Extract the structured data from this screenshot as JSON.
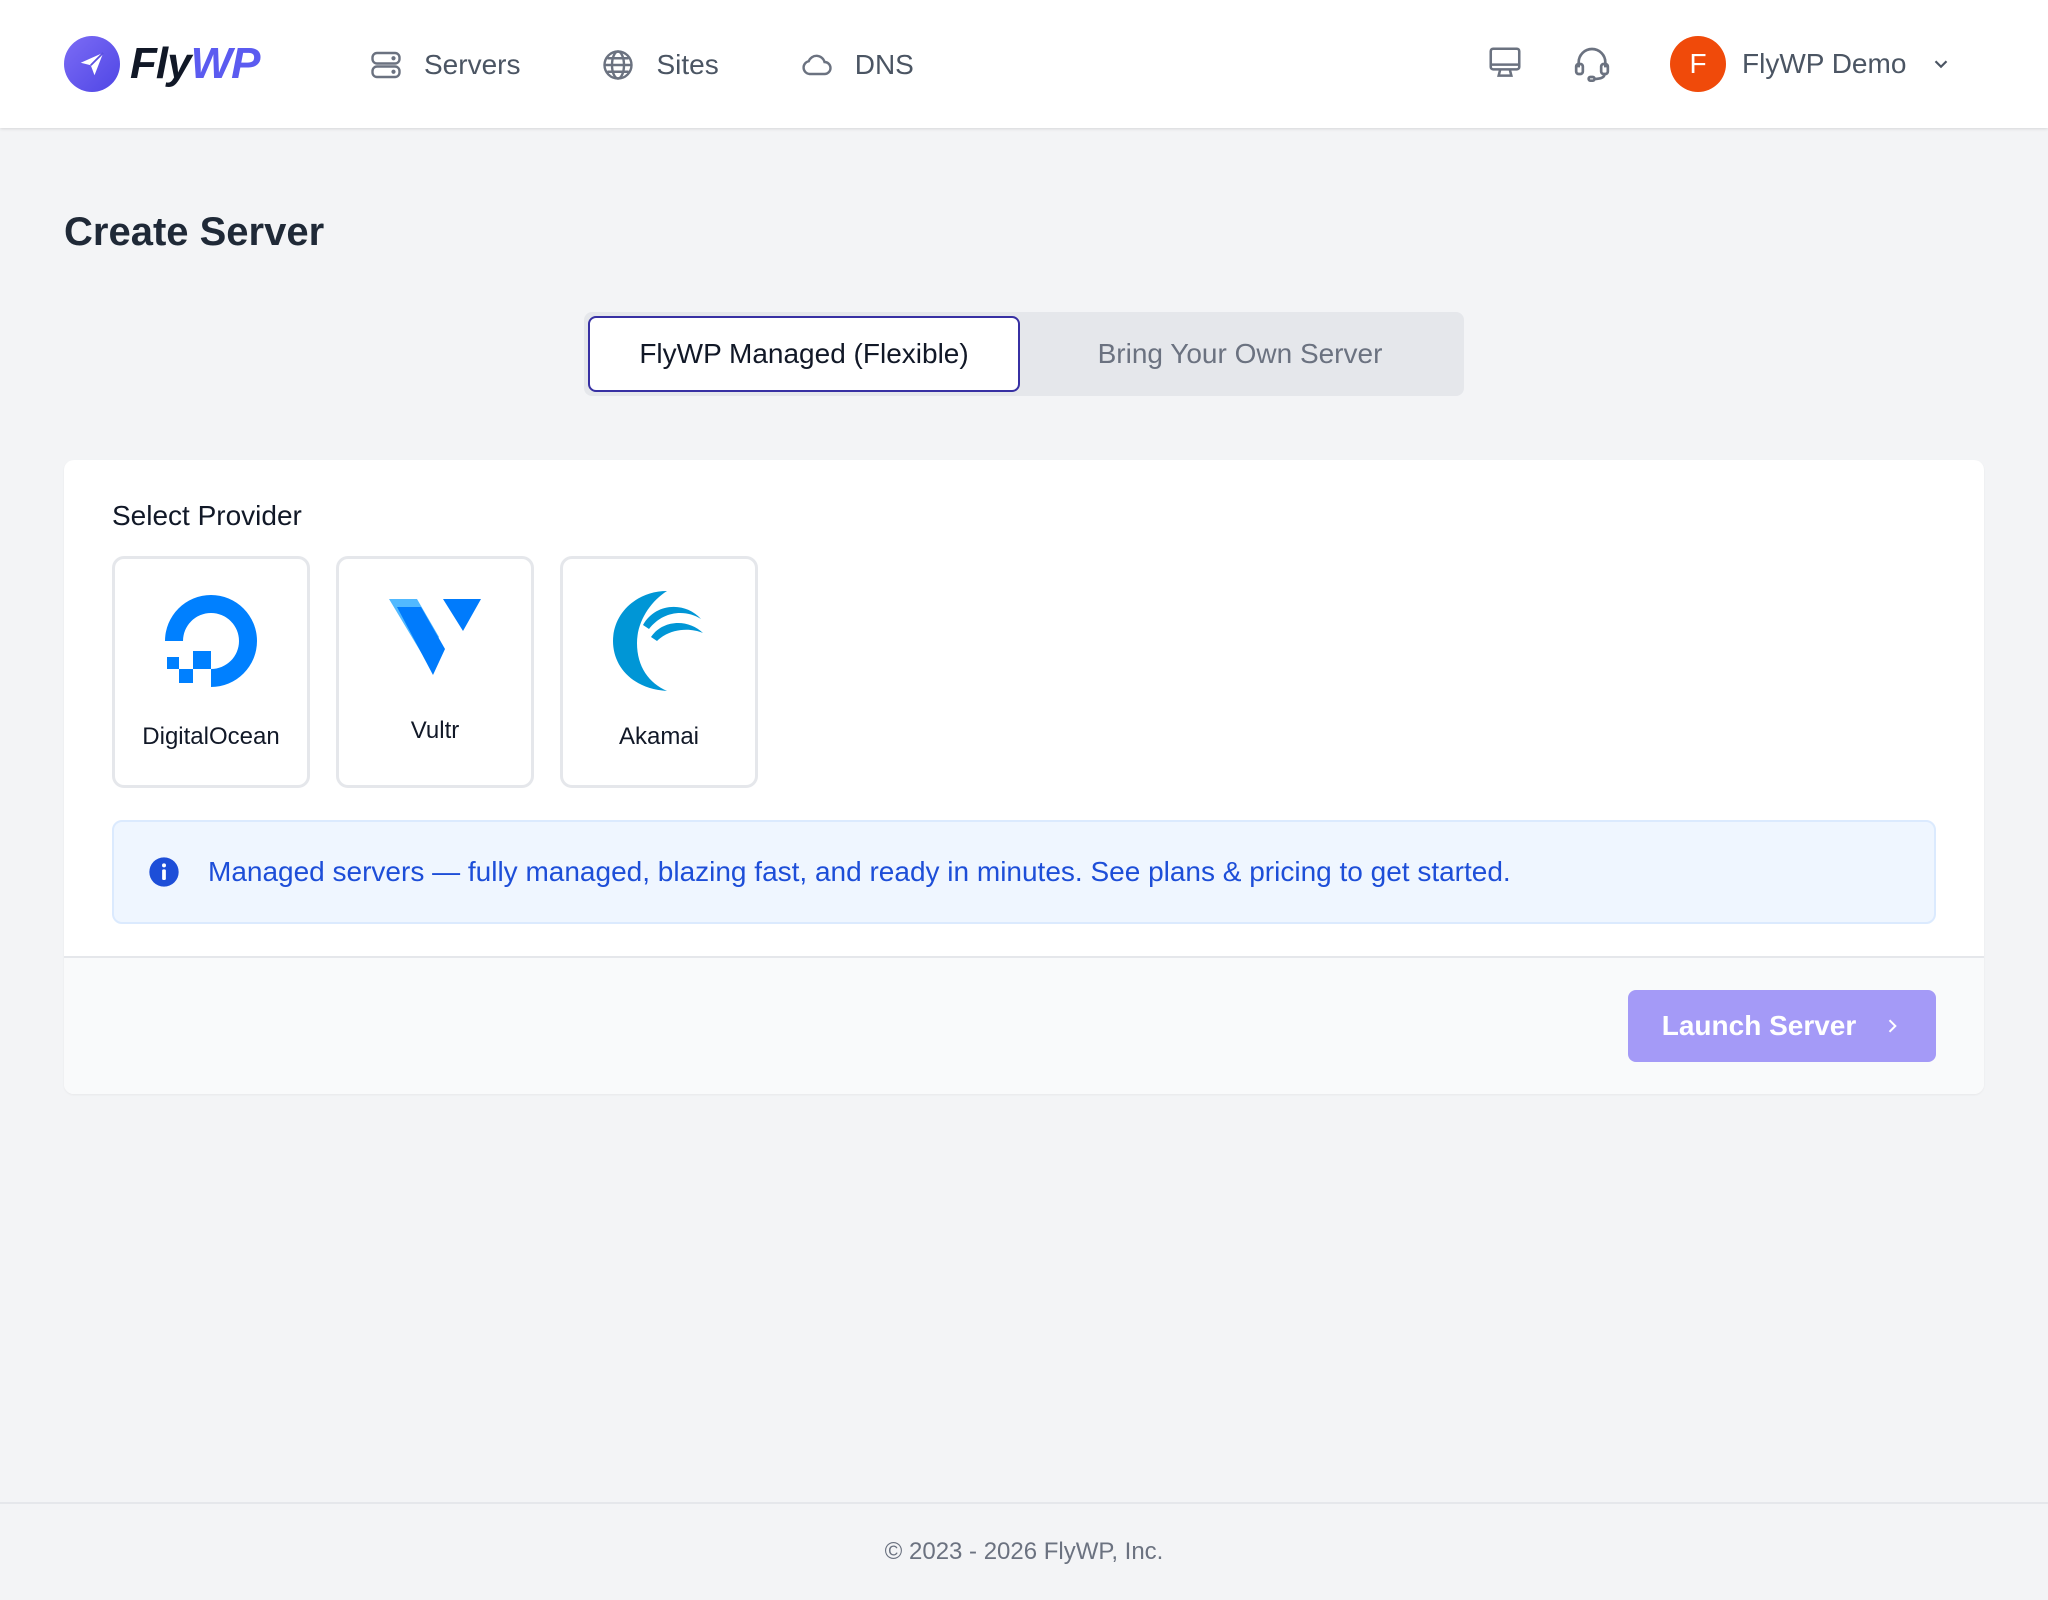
{
  "header": {
    "logo": {
      "text_fly": "Fly",
      "text_wp": "WP",
      "icon": "paper-plane-icon"
    },
    "nav": [
      {
        "label": "Servers",
        "icon": "server-stack-icon"
      },
      {
        "label": "Sites",
        "icon": "globe-icon"
      },
      {
        "label": "DNS",
        "icon": "cloud-icon"
      }
    ],
    "tools": [
      {
        "icon": "monitor-icon"
      },
      {
        "icon": "headset-support-icon"
      }
    ],
    "user": {
      "initial": "F",
      "name": "FlyWP Demo",
      "avatar_color": "#f04a0a"
    }
  },
  "page": {
    "title": "Create Server",
    "tabs": [
      {
        "label": "FlyWP Managed (Flexible)",
        "active": true
      },
      {
        "label": "Bring Your Own Server",
        "active": false
      }
    ]
  },
  "provider_section": {
    "label": "Select Provider",
    "providers": [
      {
        "name": "DigitalOcean",
        "icon": "digitalocean-logo",
        "color": "#0080ff"
      },
      {
        "name": "Vultr",
        "icon": "vultr-logo",
        "color": "#007bfc"
      },
      {
        "name": "Akamai",
        "icon": "akamai-logo",
        "color": "#0096d6"
      }
    ]
  },
  "info": {
    "icon": "info-circle-icon",
    "text": "Managed servers — fully managed, blazing fast, and ready in minutes. See plans & pricing to get started."
  },
  "actions": {
    "launch_label": "Launch Server",
    "launch_color": "#a49af7"
  },
  "footer": {
    "copyright": "© 2023 - 2026 FlyWP, Inc."
  },
  "colors": {
    "brand": "#5b5bf0",
    "active_tab_border": "#3730a3",
    "info_text": "#1d4ed8"
  }
}
